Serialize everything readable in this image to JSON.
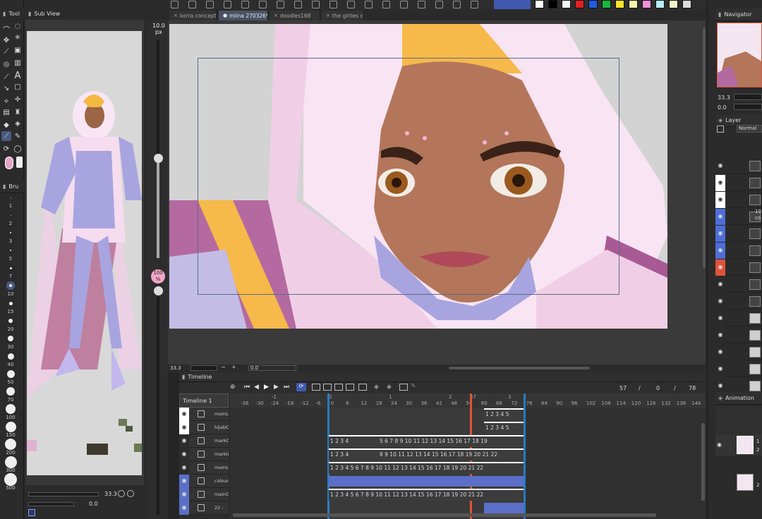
{
  "toolbar_left": {
    "tool_label": "Tool",
    "subview_label": "Sub View"
  },
  "tabs": [
    {
      "label": "korra concept",
      "active": false
    },
    {
      "label": "miina 270326*",
      "active": true
    },
    {
      "label": "doodles168",
      "active": false
    },
    {
      "label": "the girlies cole",
      "active": false
    }
  ],
  "brush": {
    "panel_label": "Bru",
    "size_value": "10.0",
    "size_unit": "px",
    "opacity_value": "100",
    "opacity_unit": "%",
    "sizes": [
      "1",
      "2",
      "3",
      "5",
      "7",
      "10",
      "15",
      "20",
      "30",
      "40",
      "50",
      "70",
      "100",
      "150",
      "200",
      "300",
      "500"
    ]
  },
  "subview_footer": {
    "zoom": "33.3",
    "rotation": "0.0"
  },
  "canvas_footer": {
    "zoom": "33.3",
    "rotation": "0.0"
  },
  "timeline": {
    "title": "Timeline",
    "name": "Timeline 1",
    "current_frame": "57",
    "slash1": "/",
    "field2": "0",
    "slash2": "/",
    "total": "78",
    "ruler_sections": [
      "-1",
      "0",
      "1",
      "2",
      "57",
      "3"
    ],
    "ruler_ticks": [
      "-36",
      "-30",
      "-24",
      "-18",
      "-12",
      "-6",
      "0",
      "6",
      "12",
      "18",
      "24",
      "30",
      "36",
      "42",
      "48",
      "54",
      "60",
      "66",
      "72",
      "78",
      "84",
      "90",
      "96",
      "102",
      "108",
      "114",
      "120",
      "126",
      "132",
      "138",
      "144"
    ],
    "rows": [
      {
        "name": "mainL",
        "frames": "1 2 3 4 5"
      },
      {
        "name": "hijabCL",
        "frames": "1 2 3 4 5"
      },
      {
        "name": "markCL",
        "frames_a": "1 2 3 4",
        "frames_b": "5 6 7 8 9 10 11 12 13 14 15 16 17 18 19"
      },
      {
        "name": "markings",
        "frames_a": "1 2 3 4",
        "frames_b": "8 9 10 11 12 13 14 15 16 17 18 19 20 21 22"
      },
      {
        "name": "mainL",
        "frames": "1 2 3 4 5 6 7 8 9 10 11 12 13 14 15 16 17 18 19 20 21 22"
      },
      {
        "name": "colour",
        "frames": ""
      },
      {
        "name": "mainC",
        "frames": "1 2 3 4 5 6 7 8 9 10 11 12 13 14 15 16 17 18 19 20 21 22"
      },
      {
        "name": "22 :",
        "frames": ""
      }
    ]
  },
  "navigator": {
    "label": "Navigator",
    "zoom": "33.3",
    "rotation": "0.0"
  },
  "layer": {
    "label": "Layer",
    "blend_mode": "Normal",
    "folder_label_a": "10",
    "folder_label_b": "co"
  },
  "animation": {
    "label": "Animation",
    "cel_label_a": "1",
    "cel_label_b": "2",
    "cel2_label": "2"
  },
  "colors": {
    "bg": "#2a2a2a",
    "panel": "#333333",
    "accent_blue": "#4e6ed8",
    "playhead_red": "#e0533a",
    "selected_tab": "#4a5266",
    "cel_blue": "#5b6fc8"
  },
  "palette": [
    "#ffffff",
    "#000000",
    "#f4f4f4",
    "#e02020",
    "#1f5de0",
    "#16b83a",
    "#f5e32a",
    "#f8f0b0",
    "#f48fd8",
    "#b5ecf5",
    "#f2f2c8",
    "#dcdcdc"
  ]
}
